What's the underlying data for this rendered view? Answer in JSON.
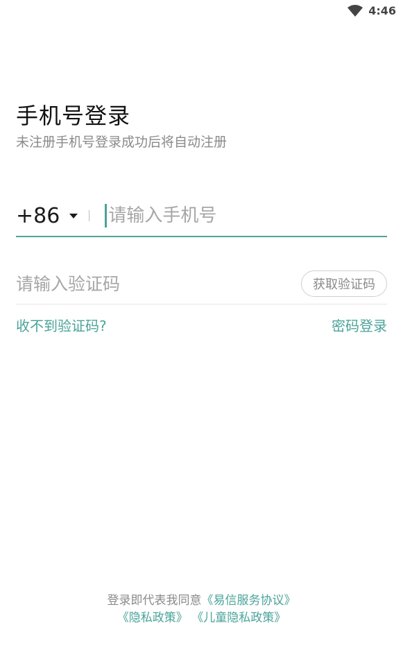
{
  "status_bar": {
    "time": "4:46",
    "icons": [
      "wifi-icon"
    ]
  },
  "header": {
    "title": "手机号登录",
    "subtitle": "未注册手机号登录成功后将自动注册"
  },
  "phone_field": {
    "country_code": "+86",
    "placeholder": "请输入手机号",
    "value": ""
  },
  "code_field": {
    "placeholder": "请输入验证码",
    "value": "",
    "get_code_label": "获取验证码"
  },
  "links": {
    "no_code": "收不到验证码?",
    "password_login": "密码登录"
  },
  "agreement": {
    "prefix": "登录即代表我同意",
    "service_agreement": "《易信服务协议》",
    "privacy_policy": "《隐私政策》",
    "children_privacy_policy": "《儿童隐私政策》"
  },
  "colors": {
    "accent": "#4aa39a",
    "text_primary": "#1b1b1b",
    "text_secondary": "#8a8a8a"
  }
}
